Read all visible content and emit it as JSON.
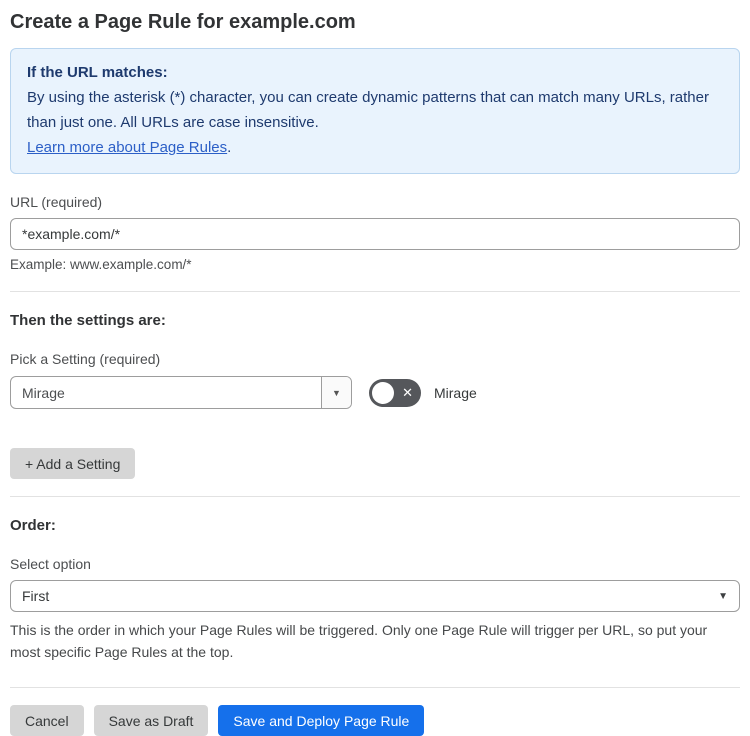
{
  "page": {
    "title": "Create a Page Rule for example.com"
  },
  "info_box": {
    "heading": "If the URL matches:",
    "body": "By using the asterisk (*) character, you can create dynamic patterns that can match many URLs, rather than just one. All URLs are case insensitive.",
    "link_label": "Learn more about Page Rules",
    "link_suffix": "."
  },
  "url_field": {
    "label": "URL (required)",
    "value": "*example.com/*",
    "example": "Example: www.example.com/*"
  },
  "settings_section": {
    "heading": "Then the settings are:",
    "picker_label": "Pick a Setting (required)",
    "picker_value": "Mirage",
    "toggle_label": "Mirage",
    "toggle_state": "off",
    "add_button_label": "+ Add a Setting"
  },
  "order_section": {
    "heading": "Order:",
    "select_label": "Select option",
    "select_value": "First",
    "help_text": "This is the order in which your Page Rules will be triggered. Only one Page Rule will trigger per URL, so put your most specific Page Rules at the top."
  },
  "footer": {
    "cancel_label": "Cancel",
    "save_draft_label": "Save as Draft",
    "save_deploy_label": "Save and Deploy Page Rule"
  },
  "icons": {
    "dropdown_arrow": "▼",
    "toggle_x": "✕"
  },
  "colors": {
    "info_background": "#e9f3fd",
    "info_border": "#b9d5ef",
    "info_text": "#1e3a6e",
    "link_blue": "#2c5fc7",
    "primary_button_blue": "#1570eb",
    "secondary_button_gray": "#d6d6d6",
    "toggle_off_gray": "#55575b"
  }
}
